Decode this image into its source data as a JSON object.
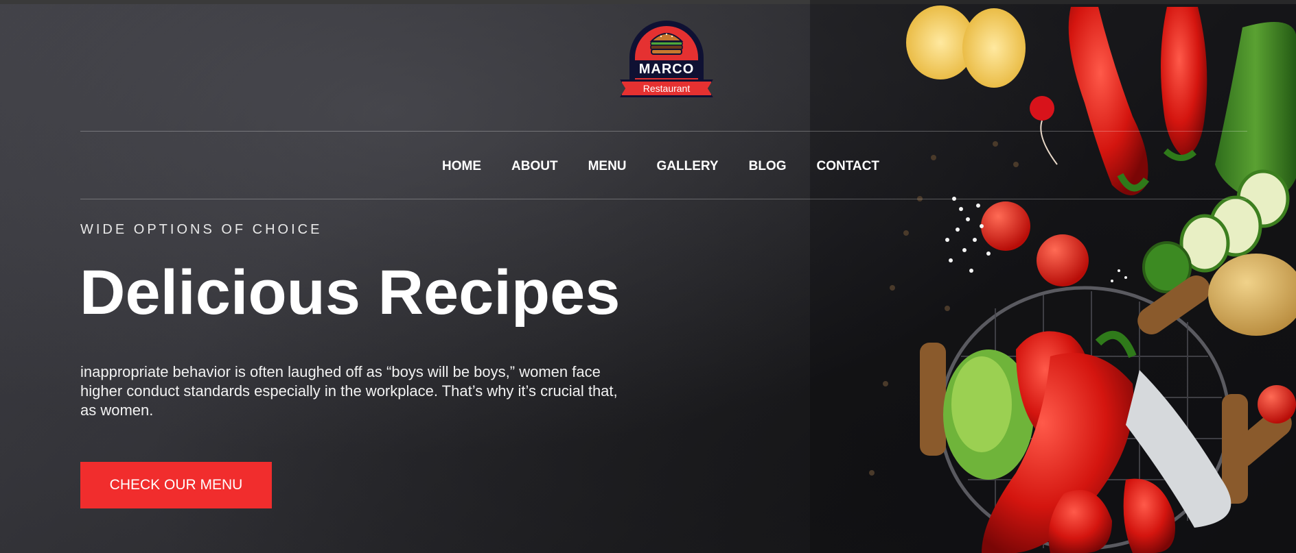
{
  "brand": {
    "name": "MARCO",
    "tagline": "Restaurant",
    "logo_icon": "burger-icon"
  },
  "nav": {
    "items": [
      {
        "label": "HOME"
      },
      {
        "label": "ABOUT"
      },
      {
        "label": "MENU"
      },
      {
        "label": "GALLERY"
      },
      {
        "label": "BLOG"
      },
      {
        "label": "CONTACT"
      }
    ]
  },
  "hero": {
    "eyebrow": "WIDE OPTIONS OF CHOICE",
    "title": "Delicious Recipes",
    "description": "inappropriate behavior is often laughed off as “boys will be boys,” women face higher conduct standards especially in the workplace. That’s why it’s crucial that, as women.",
    "cta_label": "CHECK OUR MENU"
  },
  "colors": {
    "accent": "#f12d2d",
    "logo_navy": "#0f1133",
    "background": "#2a2a2e"
  }
}
